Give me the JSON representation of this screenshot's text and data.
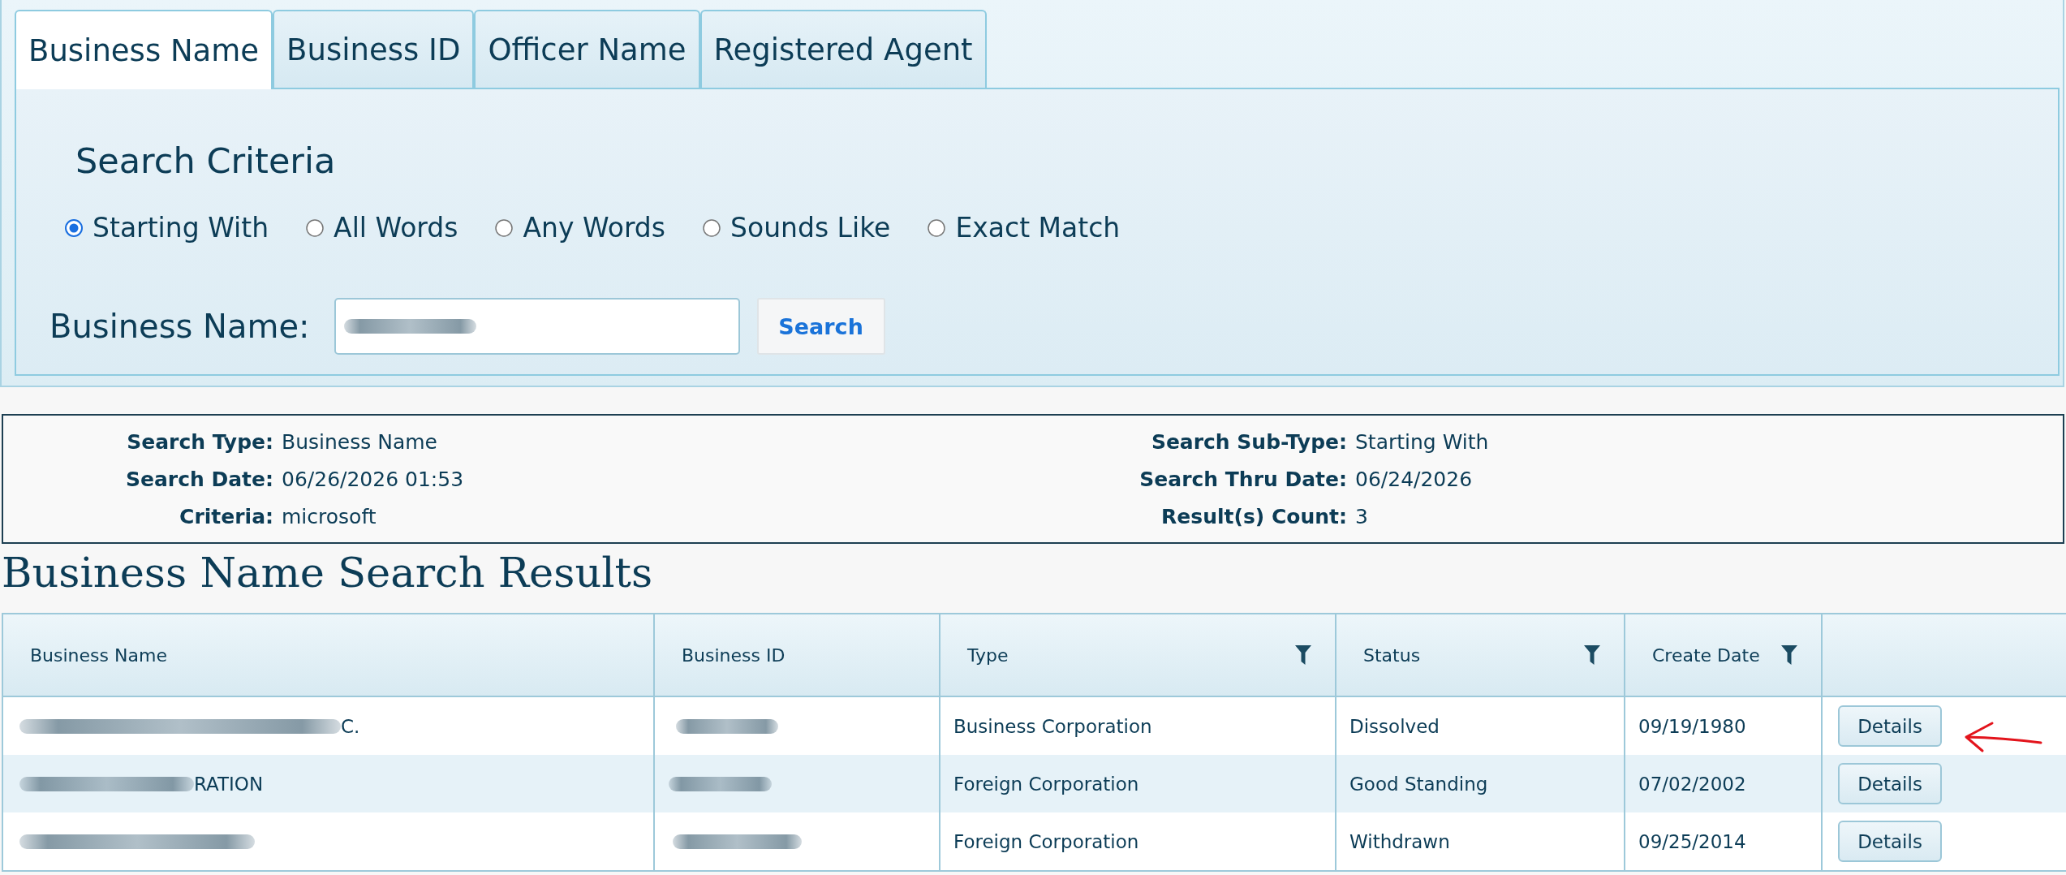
{
  "tabs": [
    {
      "label": "Business Name",
      "selected": true
    },
    {
      "label": "Business ID",
      "selected": false
    },
    {
      "label": "Officer Name",
      "selected": false
    },
    {
      "label": "Registered Agent",
      "selected": false
    }
  ],
  "search_panel": {
    "heading": "Search Criteria",
    "match_options": [
      {
        "label": "Starting With",
        "selected": true
      },
      {
        "label": "All Words",
        "selected": false
      },
      {
        "label": "Any Words",
        "selected": false
      },
      {
        "label": "Sounds Like",
        "selected": false
      },
      {
        "label": "Exact Match",
        "selected": false
      }
    ],
    "field": {
      "label": "Business Name:",
      "redacted": true
    },
    "button": "Search"
  },
  "summary": {
    "left": [
      {
        "label": "Search Type:",
        "value": "Business Name"
      },
      {
        "label": "Search Date:",
        "value": "06/26/2026 01:53"
      },
      {
        "label": "Criteria:",
        "value": "microsoft"
      }
    ],
    "right": [
      {
        "label": "Search Sub-Type:",
        "value": "Starting With"
      },
      {
        "label": "Search Thru Date:",
        "value": "06/24/2026"
      },
      {
        "label": "Result(s) Count:",
        "value": "3"
      }
    ]
  },
  "results": {
    "title": "Business Name Search Results",
    "columns": [
      {
        "label": "Business Name",
        "filter": false
      },
      {
        "label": "Business ID",
        "filter": false
      },
      {
        "label": "Type",
        "filter": true
      },
      {
        "label": "Status",
        "filter": true
      },
      {
        "label": "Create Date",
        "filter": true
      }
    ],
    "rows": [
      {
        "business_name": {
          "redacted": true,
          "visible_end": "C."
        },
        "business_id": {
          "redacted": true
        },
        "type": "Business Corporation",
        "status": "Dissolved",
        "create_date": "09/19/1980",
        "action": "Details",
        "marked": true
      },
      {
        "business_name": {
          "redacted": true,
          "visible_end": "RATION"
        },
        "business_id": {
          "redacted": true
        },
        "type": "Foreign Corporation",
        "status": "Good Standing",
        "create_date": "07/02/2002",
        "action": "Details",
        "marked": false
      },
      {
        "business_name": {
          "redacted": true
        },
        "business_id": {
          "redacted": true
        },
        "type": "Foreign Corporation",
        "status": "Withdrawn",
        "create_date": "09/25/2014",
        "action": "Details",
        "marked": false
      }
    ]
  }
}
